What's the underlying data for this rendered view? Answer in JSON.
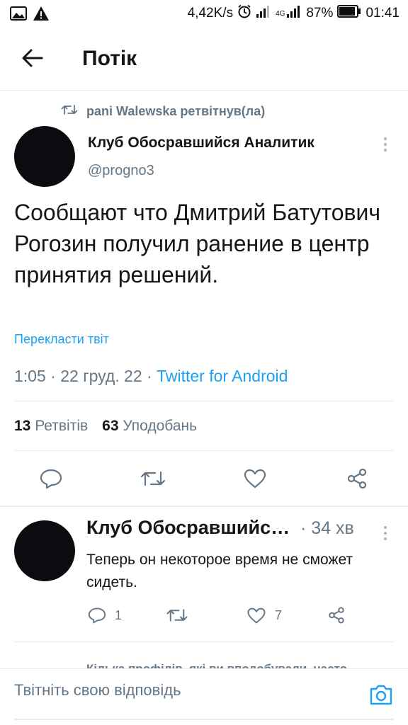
{
  "status_bar": {
    "net_speed": "4,42K/s",
    "network_type": "4G",
    "battery": "87%",
    "time": "01:41",
    "icons": [
      "image-icon",
      "warning-icon",
      "alarm-icon",
      "signal-icon",
      "signal-4g-icon",
      "battery-icon"
    ]
  },
  "header": {
    "title": "Потік",
    "back_icon": "arrow-left-icon"
  },
  "retweet_context": {
    "text": "pani Walewska ретвітнув(ла)",
    "icon": "retweet-icon"
  },
  "tweet": {
    "author_name": "Клуб Обосравшийся Аналитик",
    "author_handle": "@progno3",
    "text": "Сообщают что Дмитрий Батутович Рогозин получил ранение в центр принятия решений.",
    "translate_label": "Перекласти твіт",
    "time": "1:05",
    "date": "22 груд. 22",
    "client": "Twitter for Android",
    "separator": "·",
    "retweets_count": "13",
    "retweets_label": "Ретвітів",
    "likes_count": "63",
    "likes_label": "Уподобань",
    "actions": [
      "reply-icon",
      "retweet-icon",
      "like-icon",
      "share-icon"
    ]
  },
  "reply": {
    "author_name": "Клуб Обосравшийся Аналитик",
    "time": "· 34 хв",
    "text": "Теперь он некоторое время не сможет сидеть.",
    "reply_count": "1",
    "like_count": "7"
  },
  "suggestion_peek": {
    "text": "Кілька профілів, які ви вподобували, часто"
  },
  "composer": {
    "placeholder": "Твітніть свою відповідь",
    "camera_icon": "camera-icon"
  },
  "colors": {
    "accent": "#1da1f2",
    "secondary_text": "#657786",
    "divider": "#e6ecf0",
    "avatar": "#0c0c10"
  }
}
